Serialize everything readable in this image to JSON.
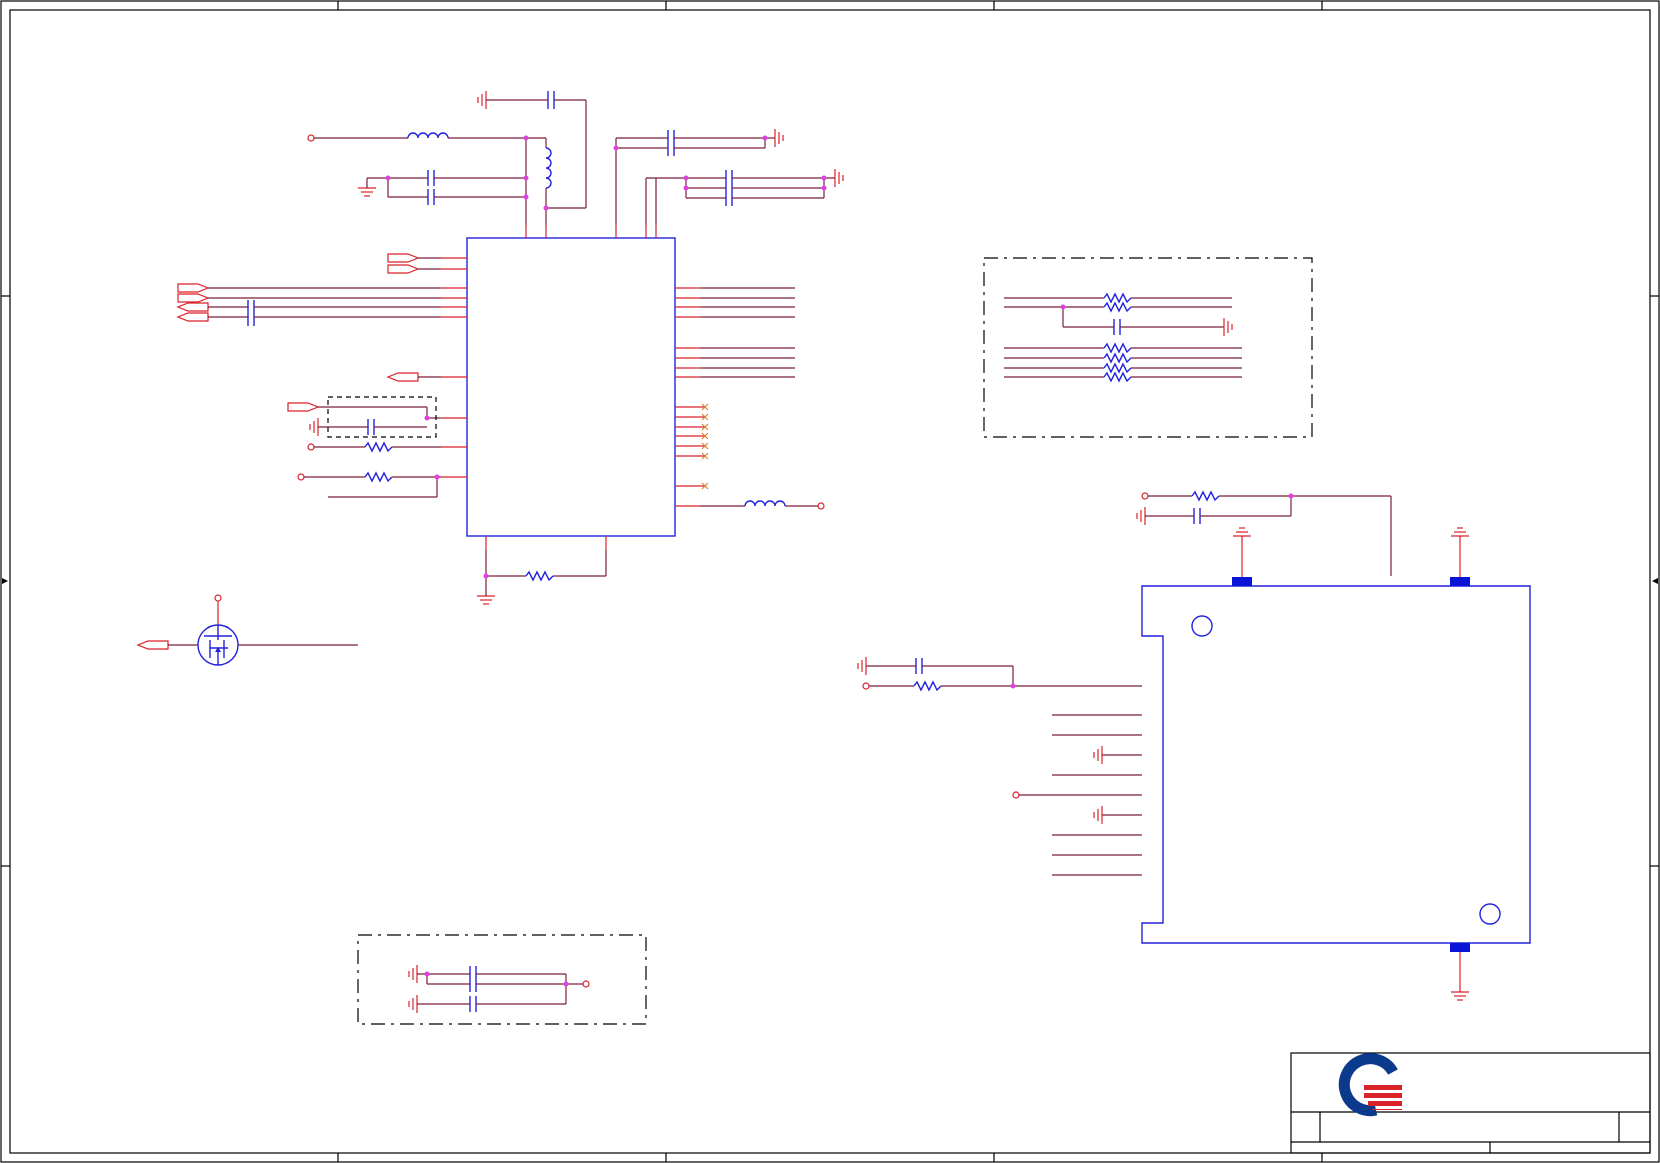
{
  "diagram": {
    "type": "electronic-schematic-sheet",
    "colors": {
      "wire": "#7a1f3d",
      "pin": "#d9222a",
      "component": "#2222dd",
      "junction": "#e040e0",
      "pad": "#0a14d6",
      "logo_blue": "#0b3a8c",
      "logo_red": "#d9222a"
    },
    "icons": [
      "ground-icon",
      "capacitor-icon",
      "resistor-icon",
      "inductor-icon",
      "mosfet-icon",
      "port-arrow-icon",
      "power-pin-icon",
      "company-logo-icon"
    ]
  }
}
